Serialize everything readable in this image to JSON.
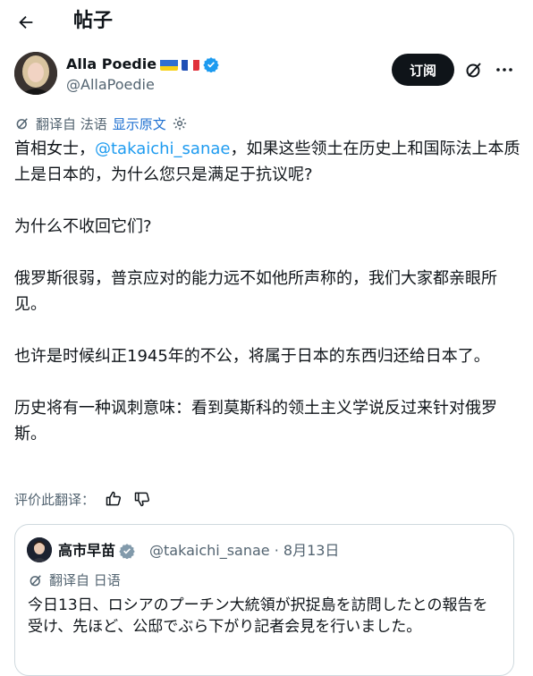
{
  "header": {
    "title": "帖子"
  },
  "author": {
    "name": "Alla Poedie",
    "handle": "@AllaPoedie",
    "subscribe_label": "订阅"
  },
  "translation": {
    "from_label": "翻译自 法语",
    "show_original": "显示原文"
  },
  "post": {
    "paragraphs": [
      {
        "before": "首相女士，",
        "mention": "@takaichi_sanae",
        "after": "，如果这些领土在历史上和国际法上本质上是日本的，为什么您只是满足于抗议呢?"
      },
      {
        "text": "为什么不收回它们?"
      },
      {
        "text": "俄罗斯很弱，普京应对的能力远不如他所声称的，我们大家都亲眼所见。"
      },
      {
        "text": "也许是时候纠正1945年的不公，将属于日本的东西归还给日本了。"
      },
      {
        "text": "历史将有一种讽刺意味：看到莫斯科的领土主义学说反过来针对俄罗斯。"
      }
    ]
  },
  "rate": {
    "label": "评价此翻译："
  },
  "quote": {
    "name": "高市早苗",
    "handle_date": "@takaichi_sanae · 8月13日",
    "translated_label": "翻译自 日语",
    "text": "今日13日、ロシアのプーチン大統領が択捉島を訪問したとの報告を受け、先ほど、公邸でぶら下がり記者会見を行いました。"
  },
  "colors": {
    "link": "#1d9bf0",
    "verified": "#1d9bf0",
    "button_bg": "#0f1419",
    "secondary": "#536471"
  }
}
